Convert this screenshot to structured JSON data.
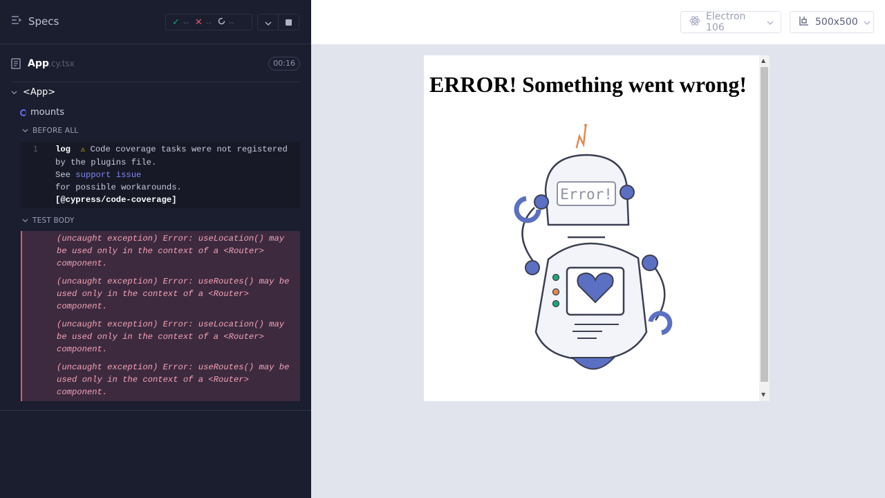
{
  "reporter": {
    "specs_label": "Specs",
    "stats": {
      "passed": "--",
      "failed": "--",
      "pending": "--"
    },
    "file": {
      "name": "App",
      "ext": ".cy.tsx",
      "duration": "00:16"
    },
    "suite_title": "<App>",
    "test_title": "mounts",
    "before_all_label": "BEFORE ALL",
    "test_body_label": "TEST BODY",
    "command_log": {
      "number": "1",
      "command": "log",
      "text_1": "Code coverage tasks were not registered",
      "text_2": "by the plugins file.",
      "see": "See",
      "link": "support issue",
      "text_3": "for possible workarounds.",
      "tag": "[@cypress/code-coverage]"
    },
    "errors": [
      {
        "line1": "(uncaught exception)  Error: useLocation() may",
        "line2": "be used only in the context of a <Router>",
        "line3": "component."
      },
      {
        "line1": "(uncaught exception)  Error: useRoutes() may be",
        "line2": "used only in the context of a <Router>",
        "line3": "component."
      },
      {
        "line1": "(uncaught exception)  Error: useLocation() may",
        "line2": "be used only in the context of a <Router>",
        "line3": "component."
      },
      {
        "line1": "(uncaught exception)  Error: useRoutes() may be",
        "line2": "used only in the context of a <Router>",
        "line3": "component."
      }
    ]
  },
  "preview": {
    "browser": "Electron 106",
    "viewport": "500x500",
    "heading": "ERROR! Something went wrong!",
    "robot_screen_text": "Error!"
  },
  "colors": {
    "reporter_bg": "#1b1e2e",
    "preview_bg": "#e1e3ed",
    "accent": "#6470f3",
    "error": "#e45770",
    "passed": "#1fa971",
    "robot_blue": "#5b6fc3",
    "robot_orange": "#e08a50"
  },
  "icons": [
    "specs-list-icon",
    "check-icon",
    "x-icon",
    "spinner-icon",
    "chevron-down-icon",
    "stop-icon",
    "file-icon",
    "warning-icon",
    "electron-icon",
    "viewport-icon"
  ]
}
